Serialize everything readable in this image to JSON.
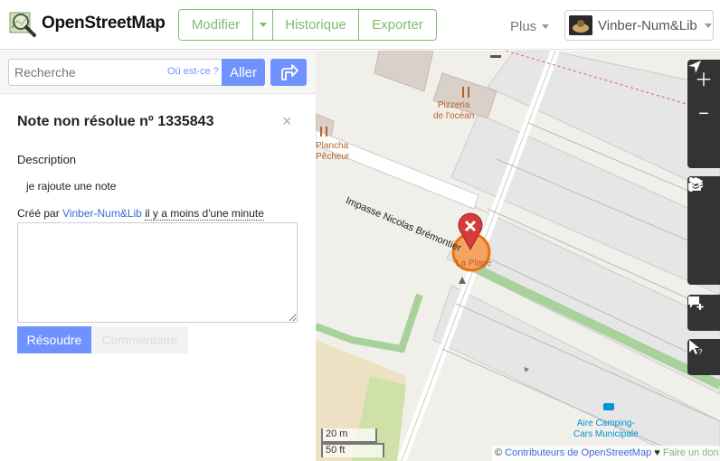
{
  "header": {
    "title": "OpenStreetMap",
    "edit_label": "Modifier",
    "history_label": "Historique",
    "export_label": "Exporter",
    "more_label": "Plus",
    "username": "Vinber-Num&Lib"
  },
  "search": {
    "placeholder": "Recherche",
    "where_label": "Où est-ce ?",
    "go_label": "Aller"
  },
  "note": {
    "title": "Note non résolue nº 1335843",
    "close": "×",
    "description_label": "Description",
    "description_text": "je rajoute une note",
    "created_prefix": "Créé par",
    "created_user": "Vinber-Num&Lib",
    "created_time": "il y a moins d'une minute",
    "resolve_label": "Résoudre",
    "comment_label": "Commentaire"
  },
  "map": {
    "labels": {
      "pizzeria": "Pizzeria\nde l'océan",
      "plancha": "Plancha\nPêcheur",
      "street": "Impasse Nicolas Brémontier",
      "plage": "La Plage",
      "camping": "Aire Camping-\nCars Municipale"
    },
    "scale_m": "20 m",
    "scale_ft": "50 ft",
    "attribution_prefix": "©",
    "attribution_link": "Contributeurs de OpenStreetMap",
    "attribution_heart": "♥",
    "attribution_donate": "Faire un don"
  },
  "colors": {
    "accent": "#7ebc6f",
    "primary": "#7092ff",
    "note_marker": "#d63c3c"
  }
}
